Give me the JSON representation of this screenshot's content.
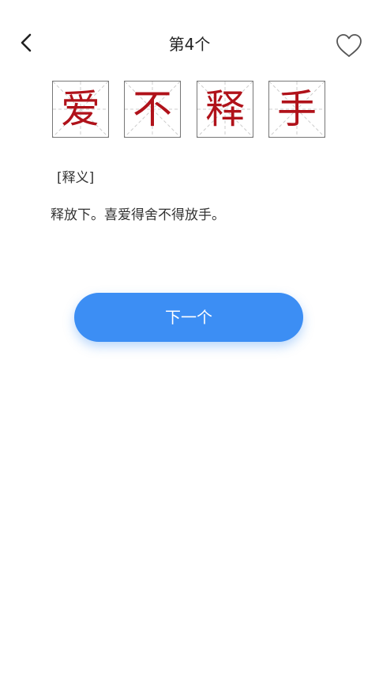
{
  "header": {
    "back_icon": "chevron-left-icon",
    "title": "第4个",
    "favorite_icon": "heart-outline-icon"
  },
  "idiom": {
    "characters": [
      "爱",
      "不",
      "释",
      "手"
    ],
    "char_color": "#b0121a"
  },
  "definition": {
    "label": "[释义]",
    "text": "释放下。喜爱得舍不得放手。"
  },
  "actions": {
    "next_label": "下一个",
    "accent_color": "#3c8ef4"
  }
}
